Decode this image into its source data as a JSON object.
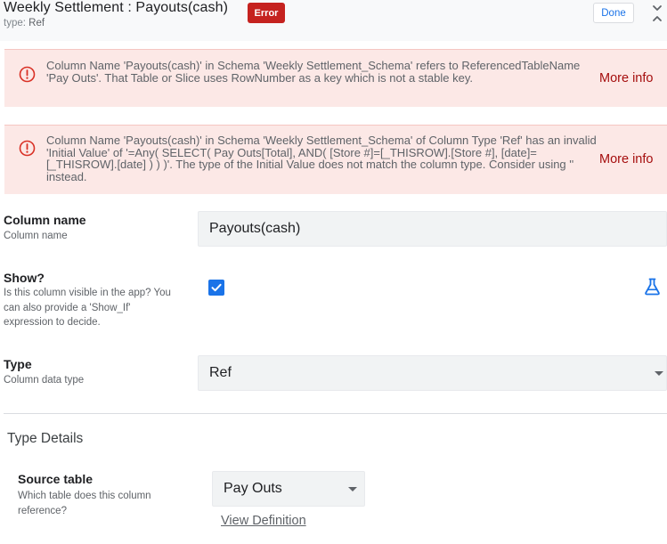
{
  "header": {
    "title": "Weekly Settlement : Payouts(cash)",
    "type_prefix": "type:",
    "type_value": "Ref",
    "error_badge": "Error",
    "done_label": "Done"
  },
  "alerts": [
    {
      "text": "Column Name 'Payouts(cash)' in Schema 'Weekly Settlement_Schema' refers to ReferencedTableName 'Pay Outs'. That Table or Slice uses RowNumber as a key which is not a stable key.",
      "more_info": "More info"
    },
    {
      "text": "Column Name 'Payouts(cash)' in Schema 'Weekly Settlement_Schema' of Column Type 'Ref' has an invalid 'Initial Value' of '=Any( SELECT( Pay Outs[Total], AND( [Store #]=[_THISROW].[Store #], [date]=[_THISROW].[date] ) ) )'. The type of the Initial Value does not match the column type. Consider using '' instead.",
      "more_info": "More info"
    }
  ],
  "column_name": {
    "label": "Column name",
    "help": "Column name",
    "value": "Payouts(cash)"
  },
  "show": {
    "label": "Show?",
    "help": "Is this column visible in the app? You can also provide a 'Show_If' expression to decide.",
    "checked": true
  },
  "type": {
    "label": "Type",
    "help": "Column data type",
    "value": "Ref"
  },
  "type_details": {
    "title": "Type Details",
    "source_table": {
      "label": "Source table",
      "help": "Which table does this column reference?",
      "value": "Pay Outs"
    },
    "view_definition": "View Definition"
  },
  "colors": {
    "accent": "#1a73e8",
    "error": "#c5221f",
    "alert_bg": "#fce8e6",
    "more_info": "#a50e0e"
  }
}
